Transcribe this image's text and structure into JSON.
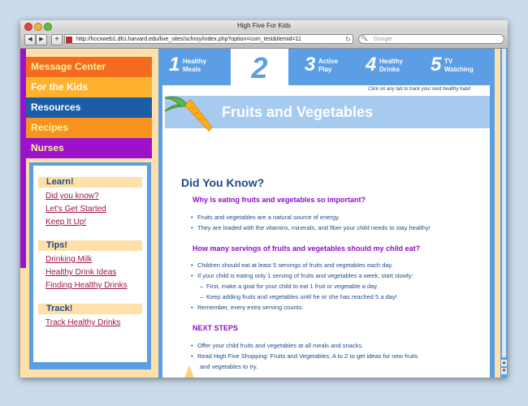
{
  "window": {
    "title": "High Five For Kids",
    "url": "http://hccxweb1.dfci.harvard.edu/live_sites/schroy/index.php?option=com_test&Itemid=11",
    "search_placeholder": "Google"
  },
  "sidebar": {
    "menu": [
      {
        "label": "Message Center",
        "bg": "#f26b1e",
        "color": "#fff3a0"
      },
      {
        "label": "For the Kids",
        "bg": "#ffb22e",
        "color": "#ffffff"
      },
      {
        "label": "Resources",
        "bg": "#1b5ea7",
        "color": "#ffffff"
      },
      {
        "label": "Recipes",
        "bg": "#f7931e",
        "color": "#fff3a0"
      },
      {
        "label": "Nurses",
        "bg": "#9b12c9",
        "color": "#fff3a0"
      }
    ],
    "sections": [
      {
        "title": "Learn!",
        "links": [
          "Did you know?",
          "Let's Get Started",
          "Keep It Up!"
        ]
      },
      {
        "title": "Tips!",
        "links": [
          "Drinking Milk",
          "Healthy Drink Ideas",
          "Finding Healthy Drinks"
        ]
      },
      {
        "title": "Track!",
        "links": [
          "Track Healthy Drinks"
        ]
      }
    ]
  },
  "tabs": [
    {
      "num": "1",
      "label": "Healthy\nMeals"
    },
    {
      "num": "2",
      "label": ""
    },
    {
      "num": "3",
      "label": "Active\nPlay"
    },
    {
      "num": "4",
      "label": "Healthy\nDrinks"
    },
    {
      "num": "5",
      "label": "TV\nWatching"
    }
  ],
  "hint": "Click on any tab to track your next healthy habit",
  "banner_title": "Fruits and Vegetables",
  "content": {
    "heading": "Did You Know?",
    "q1": "Why is eating fruits and vegetables so important?",
    "q1_bullets": [
      "Fruits and vegetables are a natural source of energy.",
      "They are loaded with the vitamins, minerals, and fiber your child needs to stay healthy!"
    ],
    "q2": "How many servings of fruits and vegetables should my child eat?",
    "q2_lines": [
      "Children should eat at least 5 servings of fruits and vegetables each day.",
      "If your child is eating only 1 serving of fruits and vegetables a week, start slowly:",
      "First, make a goal for your child to eat 1 fruit or vegetable a day.",
      "Keep adding fruits and vegetables until he or she has reached 5 a day!",
      "Remember, every extra serving counts."
    ],
    "next": "NEXT STEPS",
    "next_lines": [
      "Offer your child fruits and vegetables at all meals and snacks.",
      "Read High Five Shopping: Fruits and Vegetables, A to Z to get ideas for new fruits",
      "and vegetables to try."
    ]
  },
  "colors": {
    "accent_blue": "#5b9ee5",
    "heading_blue": "#1c4a8c",
    "question_purple": "#8d12c2",
    "link_red": "#a11448",
    "page_bg": "#ffe0a8"
  }
}
